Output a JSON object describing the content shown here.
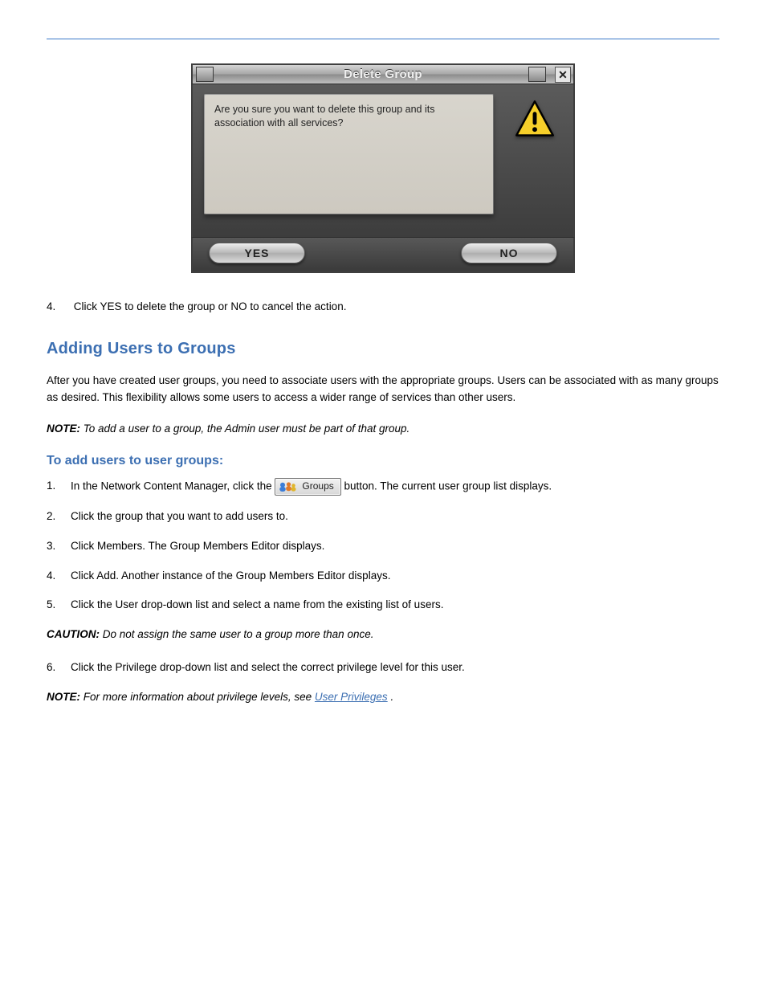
{
  "dialog": {
    "title": "Delete Group",
    "message": "Are you sure you want to delete this group and its association with all services?",
    "yes_label": "YES",
    "no_label": "NO",
    "close_label": "✕"
  },
  "after_dialog": {
    "step_num": "4.",
    "step_text": "Click YES to delete the group or NO to cancel the action."
  },
  "section": {
    "title": "Adding Users to Groups",
    "intro": "After you have created user groups, you need to associate users with the appropriate groups. Users can be associated with as many groups as desired. This flexibility allows some users to access a wider range of services than other users.",
    "note_label": "NOTE:",
    "note_text": "To add a user to a group, the Admin user must be part of that group.",
    "sub_title": "To add users to user groups:",
    "steps": [
      {
        "num": "1.",
        "text_before": "In the Network Content Manager, click the ",
        "btn_label": "Groups",
        "text_after": "  button. The current user group list displays."
      },
      {
        "num": "2.",
        "text": "Click the group that you want to add users to."
      },
      {
        "num": "3.",
        "text": "Click Members. The Group Members Editor displays."
      },
      {
        "num": "4.",
        "text": "Click Add. Another instance of the Group Members Editor displays."
      },
      {
        "num": "5.",
        "text": "Click the User drop-down list and select a name from the existing list of users."
      }
    ],
    "caution_label": "CAUTION:",
    "caution_text": "Do not assign the same user to a group more than once."
  },
  "final_steps": [
    {
      "num": "6.",
      "text": "Click the Privilege drop-down list and select the correct privilege level for this user."
    }
  ],
  "note2": {
    "label": "NOTE:",
    "before_link": "For more information about privilege levels, see ",
    "link_text": "User Privileges",
    "after_link": "."
  }
}
